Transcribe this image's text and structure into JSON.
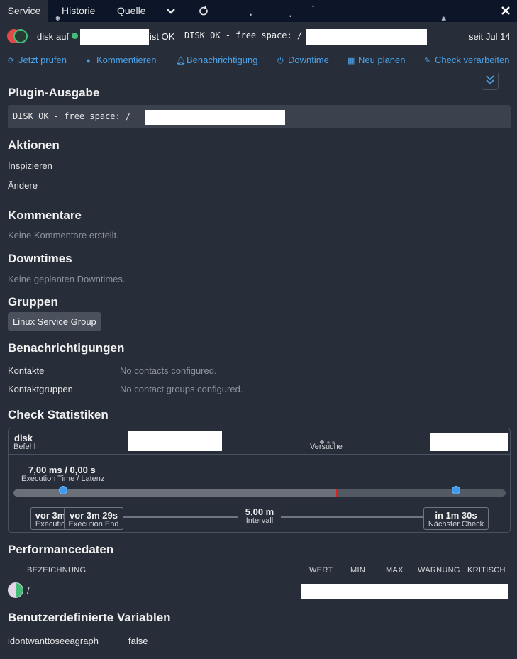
{
  "tabs": {
    "service": "Service",
    "history": "Historie",
    "source": "Quelle"
  },
  "header": {
    "service": "disk",
    "auf": "auf",
    "status": "ist OK",
    "output_prefix": "DISK OK - free space: /",
    "since": "seit Jul 14"
  },
  "actions": {
    "check_now": "Jetzt prüfen",
    "comment": "Kommentieren",
    "notification": "Benachrichtigung",
    "downtime": "Downtime",
    "reschedule": "Neu planen",
    "process_check": "Check verarbeiten"
  },
  "sections": {
    "plugin_output": {
      "title": "Plugin-Ausgabe",
      "text": "DISK OK - free space: /"
    },
    "actions": {
      "title": "Aktionen",
      "inspect": "Inspizieren",
      "modify": "Ändere"
    },
    "comments": {
      "title": "Kommentare",
      "empty": "Keine Kommentare erstellt."
    },
    "downtimes": {
      "title": "Downtimes",
      "empty": "Keine geplanten Downtimes."
    },
    "groups": {
      "title": "Gruppen",
      "group": "Linux Service Group"
    },
    "notifications": {
      "title": "Benachrichtigungen",
      "contacts_label": "Kontakte",
      "contacts_value": "No contacts configured.",
      "groups_label": "Kontaktgruppen",
      "groups_value": "No contact groups configured."
    },
    "check_stats": {
      "title": "Check Statistiken",
      "command_name": "disk",
      "command_label": "Befehl",
      "attempts_label": "Versuche",
      "exec_value": "7,00 ms / 0,00 s",
      "exec_label": "Execution Time / Latenz",
      "start_value": "vor 3m",
      "start_label": "Executio",
      "end_value": "vor 3m 29s",
      "end_label": "Execution End",
      "interval_value": "5,00 m",
      "interval_label": "Intervall",
      "next_value": "in 1m 30s",
      "next_label": "Nächster Check"
    },
    "perfdata": {
      "title": "Performancedaten",
      "columns": {
        "name": "BEZEICHNUNG",
        "value": "WERT",
        "min": "MIN",
        "max": "MAX",
        "warn": "WARNUNG",
        "crit": "KRITISCH"
      },
      "row_label": "/"
    },
    "custom_vars": {
      "title": "Benutzerdefinierte Variablen",
      "name": "idontwanttoseeagraph",
      "value": "false"
    }
  },
  "colors": {
    "ok": "#44bb77",
    "critical": "#e84747",
    "link": "#4aa3ea"
  },
  "icons": [
    "chevron-down-icon",
    "refresh-icon",
    "close-icon",
    "sync-icon",
    "comment-icon",
    "bell-icon",
    "plug-icon",
    "calendar-icon",
    "edit-icon",
    "double-chevron-down-icon"
  ]
}
